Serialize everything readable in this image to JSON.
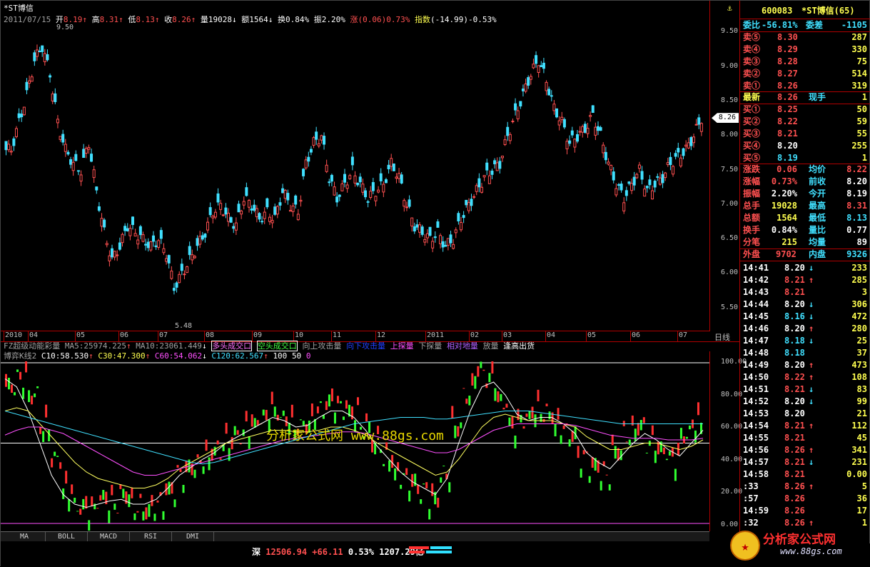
{
  "info_line_1": {
    "title": "*ST博信",
    "date": "2011/07/15",
    "open_label": "开",
    "open": "8.19",
    "high_label": "高",
    "high": "8.31",
    "low_label": "低",
    "low": "8.13",
    "close_label": "收",
    "close": "8.26",
    "vol_label": "量",
    "vol": "19028",
    "amt_label": "额",
    "amt": "1564",
    "turn_label": "换",
    "turn": "0.84%",
    "amp_label": "振",
    "amp": "2.20%",
    "chg_label": "涨",
    "chg": "(0.06)0.73%",
    "idx_label": "指数",
    "idx": "(-14.99)-0.53%"
  },
  "price_axis": [
    "9.50",
    "9.00",
    "8.50",
    "8.00",
    "7.50",
    "7.00",
    "6.50",
    "6.00",
    "5.50"
  ],
  "price_markers": {
    "max": "9.50",
    "min": "5.48",
    "current": "8.26"
  },
  "date_axis": [
    "2010",
    "04",
    "05",
    "06",
    "07",
    "08",
    "09",
    "10",
    "11",
    "12",
    "2011",
    "02",
    "03",
    "04",
    "05",
    "06",
    "07"
  ],
  "period_label": "日线",
  "indicator_1": {
    "name": "FZ超级动能彩量",
    "ma5": "MA5:25974.225",
    "ma10": "MA10:23061.449",
    "t1": "多头成交口",
    "t2": "空头成交口",
    "t3": "向上攻击量",
    "t4": "向下攻击量",
    "t5": "上探量",
    "t6": "下探量",
    "t7": "相对地量",
    "t8": "放量",
    "t9": "逢高出货"
  },
  "indicator_2": {
    "name": "博弈K线2",
    "c10": "C10:58.530",
    "c30": "C30:47.300",
    "c60": "C60:54.062",
    "c120": "C120:62.567",
    "v100": "100",
    "v50": "50",
    "v0": "0"
  },
  "osc_axis": [
    "100.00",
    "80.00",
    "60.00",
    "40.00",
    "20.00",
    "0.00"
  ],
  "watermark": "分析家公式网 www.88gs.com",
  "bottom_tabs": [
    "MA",
    "BOLL",
    "MACD",
    "RSI",
    "DMI"
  ],
  "status": {
    "market": "深",
    "index": "12506.94",
    "change": "+66.11",
    "pct": "0.53%",
    "amount": "1207.29亿"
  },
  "logo": {
    "text": "分析家公式网",
    "url": "www.88gs.com"
  },
  "panel": {
    "code": "600083",
    "name": "*ST博信(65)",
    "weibi_label": "委比",
    "weibi": "-56.81%",
    "weicha_label": "委差",
    "weicha": "-1105",
    "asks": [
      {
        "label": "卖⑤",
        "price": "8.30",
        "vol": "287"
      },
      {
        "label": "卖④",
        "price": "8.29",
        "vol": "330"
      },
      {
        "label": "卖③",
        "price": "8.28",
        "vol": "75"
      },
      {
        "label": "卖②",
        "price": "8.27",
        "vol": "514"
      },
      {
        "label": "卖①",
        "price": "8.26",
        "vol": "319"
      }
    ],
    "last_label": "最新",
    "last": "8.26",
    "now_label": "现手",
    "now": "1",
    "bids": [
      {
        "label": "买①",
        "price": "8.25",
        "vol": "50"
      },
      {
        "label": "买②",
        "price": "8.22",
        "vol": "59"
      },
      {
        "label": "买③",
        "price": "8.21",
        "vol": "55"
      },
      {
        "label": "买④",
        "price": "8.20",
        "vol": "255"
      },
      {
        "label": "买⑤",
        "price": "8.19",
        "vol": "1"
      }
    ],
    "stats": [
      {
        "l1": "涨跌",
        "v1": "0.06",
        "l2": "均价",
        "v2": "8.22"
      },
      {
        "l1": "涨幅",
        "v1": "0.73%",
        "l2": "前收",
        "v2": "8.20"
      },
      {
        "l1": "振幅",
        "v1": "2.20%",
        "l2": "今开",
        "v2": "8.19"
      },
      {
        "l1": "总手",
        "v1": "19028",
        "l2": "最高",
        "v2": "8.31"
      },
      {
        "l1": "总额",
        "v1": "1564",
        "l2": "最低",
        "v2": "8.13"
      },
      {
        "l1": "换手",
        "v1": "0.84%",
        "l2": "量比",
        "v2": "0.77"
      },
      {
        "l1": "分笔",
        "v1": "215",
        "l2": "均量",
        "v2": "89"
      }
    ],
    "outer_label": "外盘",
    "outer": "9702",
    "inner_label": "内盘",
    "inner": "9326",
    "ticks": [
      {
        "t": "14:41",
        "p": "8.20",
        "d": "↓",
        "v": "233"
      },
      {
        "t": "14:42",
        "p": "8.21",
        "d": "↑",
        "v": "285"
      },
      {
        "t": "14:43",
        "p": "8.21",
        "d": "",
        "v": "3"
      },
      {
        "t": "14:44",
        "p": "8.20",
        "d": "↓",
        "v": "306"
      },
      {
        "t": "14:45",
        "p": "8.16",
        "d": "↓",
        "v": "472"
      },
      {
        "t": "14:46",
        "p": "8.20",
        "d": "↑",
        "v": "280"
      },
      {
        "t": "14:47",
        "p": "8.18",
        "d": "↓",
        "v": "25"
      },
      {
        "t": "14:48",
        "p": "8.18",
        "d": "",
        "v": "37"
      },
      {
        "t": "14:49",
        "p": "8.20",
        "d": "↑",
        "v": "473"
      },
      {
        "t": "14:50",
        "p": "8.22",
        "d": "↑",
        "v": "108"
      },
      {
        "t": "14:51",
        "p": "8.21",
        "d": "↓",
        "v": "83"
      },
      {
        "t": "14:52",
        "p": "8.20",
        "d": "↓",
        "v": "99"
      },
      {
        "t": "14:53",
        "p": "8.20",
        "d": "",
        "v": "21"
      },
      {
        "t": "14:54",
        "p": "8.21",
        "d": "↑",
        "v": "112"
      },
      {
        "t": "14:55",
        "p": "8.21",
        "d": "",
        "v": "45"
      },
      {
        "t": "14:56",
        "p": "8.26",
        "d": "↑",
        "v": "341"
      },
      {
        "t": "14:57",
        "p": "8.21",
        "d": "↓",
        "v": "231"
      },
      {
        "t": "14:58",
        "p": "8.21",
        "d": "",
        "v": "0.00"
      },
      {
        "t": ":33",
        "p": "8.26",
        "d": "↑",
        "v": "5"
      },
      {
        "t": ":57",
        "p": "8.26",
        "d": "",
        "v": "36"
      },
      {
        "t": "14:59",
        "p": "8.26",
        "d": "",
        "v": "17"
      },
      {
        "t": ":32",
        "p": "8.26",
        "d": "↑",
        "v": "1"
      }
    ]
  },
  "colors": {
    "up": "#ff5050",
    "down": "#40e0ff",
    "grid": "#b00000",
    "osc_up": "#ff3030",
    "osc_down": "#30ff30"
  },
  "chart_data": {
    "type": "candlestick",
    "price_range": [
      5.3,
      9.65
    ],
    "close_series": [
      7.8,
      8.2,
      8.6,
      9.1,
      9.3,
      8.9,
      8.2,
      7.8,
      7.6,
      7.5,
      7.9,
      7.2,
      6.6,
      6.2,
      6.4,
      6.7,
      6.6,
      6.5,
      6.4,
      6.5,
      6.3,
      5.8,
      6.0,
      6.2,
      6.4,
      6.6,
      6.9,
      7.0,
      6.8,
      6.7,
      7.1,
      7.0,
      6.8,
      6.9,
      6.8,
      7.2,
      7.0,
      6.9,
      7.6,
      7.9,
      8.0,
      7.4,
      7.1,
      7.3,
      7.5,
      7.3,
      7.1,
      7.2,
      7.3,
      7.6,
      7.4,
      7.0,
      6.7,
      6.6,
      6.5,
      6.6,
      6.4,
      6.5,
      6.8,
      7.0,
      7.2,
      7.4,
      7.5,
      7.6,
      8.0,
      8.3,
      8.6,
      8.9,
      9.1,
      8.8,
      8.4,
      8.2,
      7.9,
      8.0,
      8.1,
      8.3,
      8.0,
      7.6,
      7.3,
      7.1,
      7.3,
      7.5,
      7.2,
      7.3,
      7.4,
      7.6,
      7.7,
      7.8,
      8.0,
      8.26
    ],
    "osc_range": [
      0,
      100
    ],
    "osc_k": [
      85,
      90,
      80,
      60,
      40,
      20,
      10,
      8,
      15,
      12,
      18,
      10,
      8,
      12,
      20,
      30,
      35,
      40,
      45,
      50,
      55,
      60,
      65,
      70,
      65,
      60,
      62,
      70,
      75,
      72,
      68,
      60,
      50,
      40,
      30,
      25,
      20,
      15,
      30,
      60,
      80,
      95,
      90,
      75,
      60,
      65,
      70,
      68,
      60,
      55,
      40,
      35,
      30,
      45,
      55,
      60,
      50,
      45,
      40,
      55,
      62
    ],
    "osc_c10": [
      90,
      85,
      70,
      50,
      30,
      18,
      12,
      10,
      12,
      14,
      15,
      12,
      12,
      15,
      22,
      30,
      35,
      40,
      44,
      50,
      54,
      58,
      62,
      66,
      64,
      60,
      61,
      66,
      70,
      70,
      66,
      58,
      48,
      40,
      32,
      26,
      22,
      18,
      28,
      50,
      70,
      85,
      88,
      80,
      68,
      64,
      66,
      66,
      62,
      56,
      44,
      38,
      34,
      42,
      50,
      56,
      52,
      46,
      42,
      50,
      58
    ],
    "osc_c30": [
      70,
      72,
      70,
      62,
      54,
      46,
      38,
      32,
      28,
      26,
      24,
      22,
      22,
      24,
      28,
      34,
      38,
      42,
      46,
      50,
      52,
      54,
      56,
      58,
      58,
      57,
      57,
      58,
      60,
      60,
      58,
      55,
      50,
      46,
      42,
      38,
      34,
      30,
      32,
      40,
      50,
      60,
      66,
      68,
      66,
      64,
      64,
      64,
      62,
      60,
      54,
      50,
      46,
      46,
      48,
      50,
      50,
      48,
      46,
      48,
      52
    ],
    "osc_c60": [
      55,
      58,
      60,
      60,
      58,
      56,
      52,
      48,
      44,
      40,
      36,
      32,
      30,
      30,
      32,
      34,
      36,
      38,
      40,
      42,
      44,
      46,
      48,
      50,
      52,
      53,
      54,
      55,
      56,
      57,
      57,
      56,
      54,
      52,
      50,
      48,
      46,
      44,
      44,
      46,
      50,
      54,
      58,
      60,
      62,
      62,
      62,
      62,
      62,
      61,
      59,
      57,
      55,
      54,
      53,
      53,
      53,
      52,
      52,
      52,
      53
    ],
    "osc_c120": [
      70,
      68,
      66,
      64,
      62,
      60,
      58,
      56,
      54,
      52,
      50,
      48,
      46,
      44,
      42,
      40,
      38,
      37,
      38,
      40,
      42,
      44,
      46,
      48,
      50,
      52,
      54,
      56,
      58,
      60,
      62,
      63,
      64,
      65,
      66,
      66,
      66,
      65,
      65,
      66,
      67,
      68,
      69,
      70,
      70,
      70,
      69,
      68,
      67,
      66,
      65,
      64,
      63,
      62,
      62,
      62,
      62,
      62,
      62,
      62,
      62
    ]
  }
}
